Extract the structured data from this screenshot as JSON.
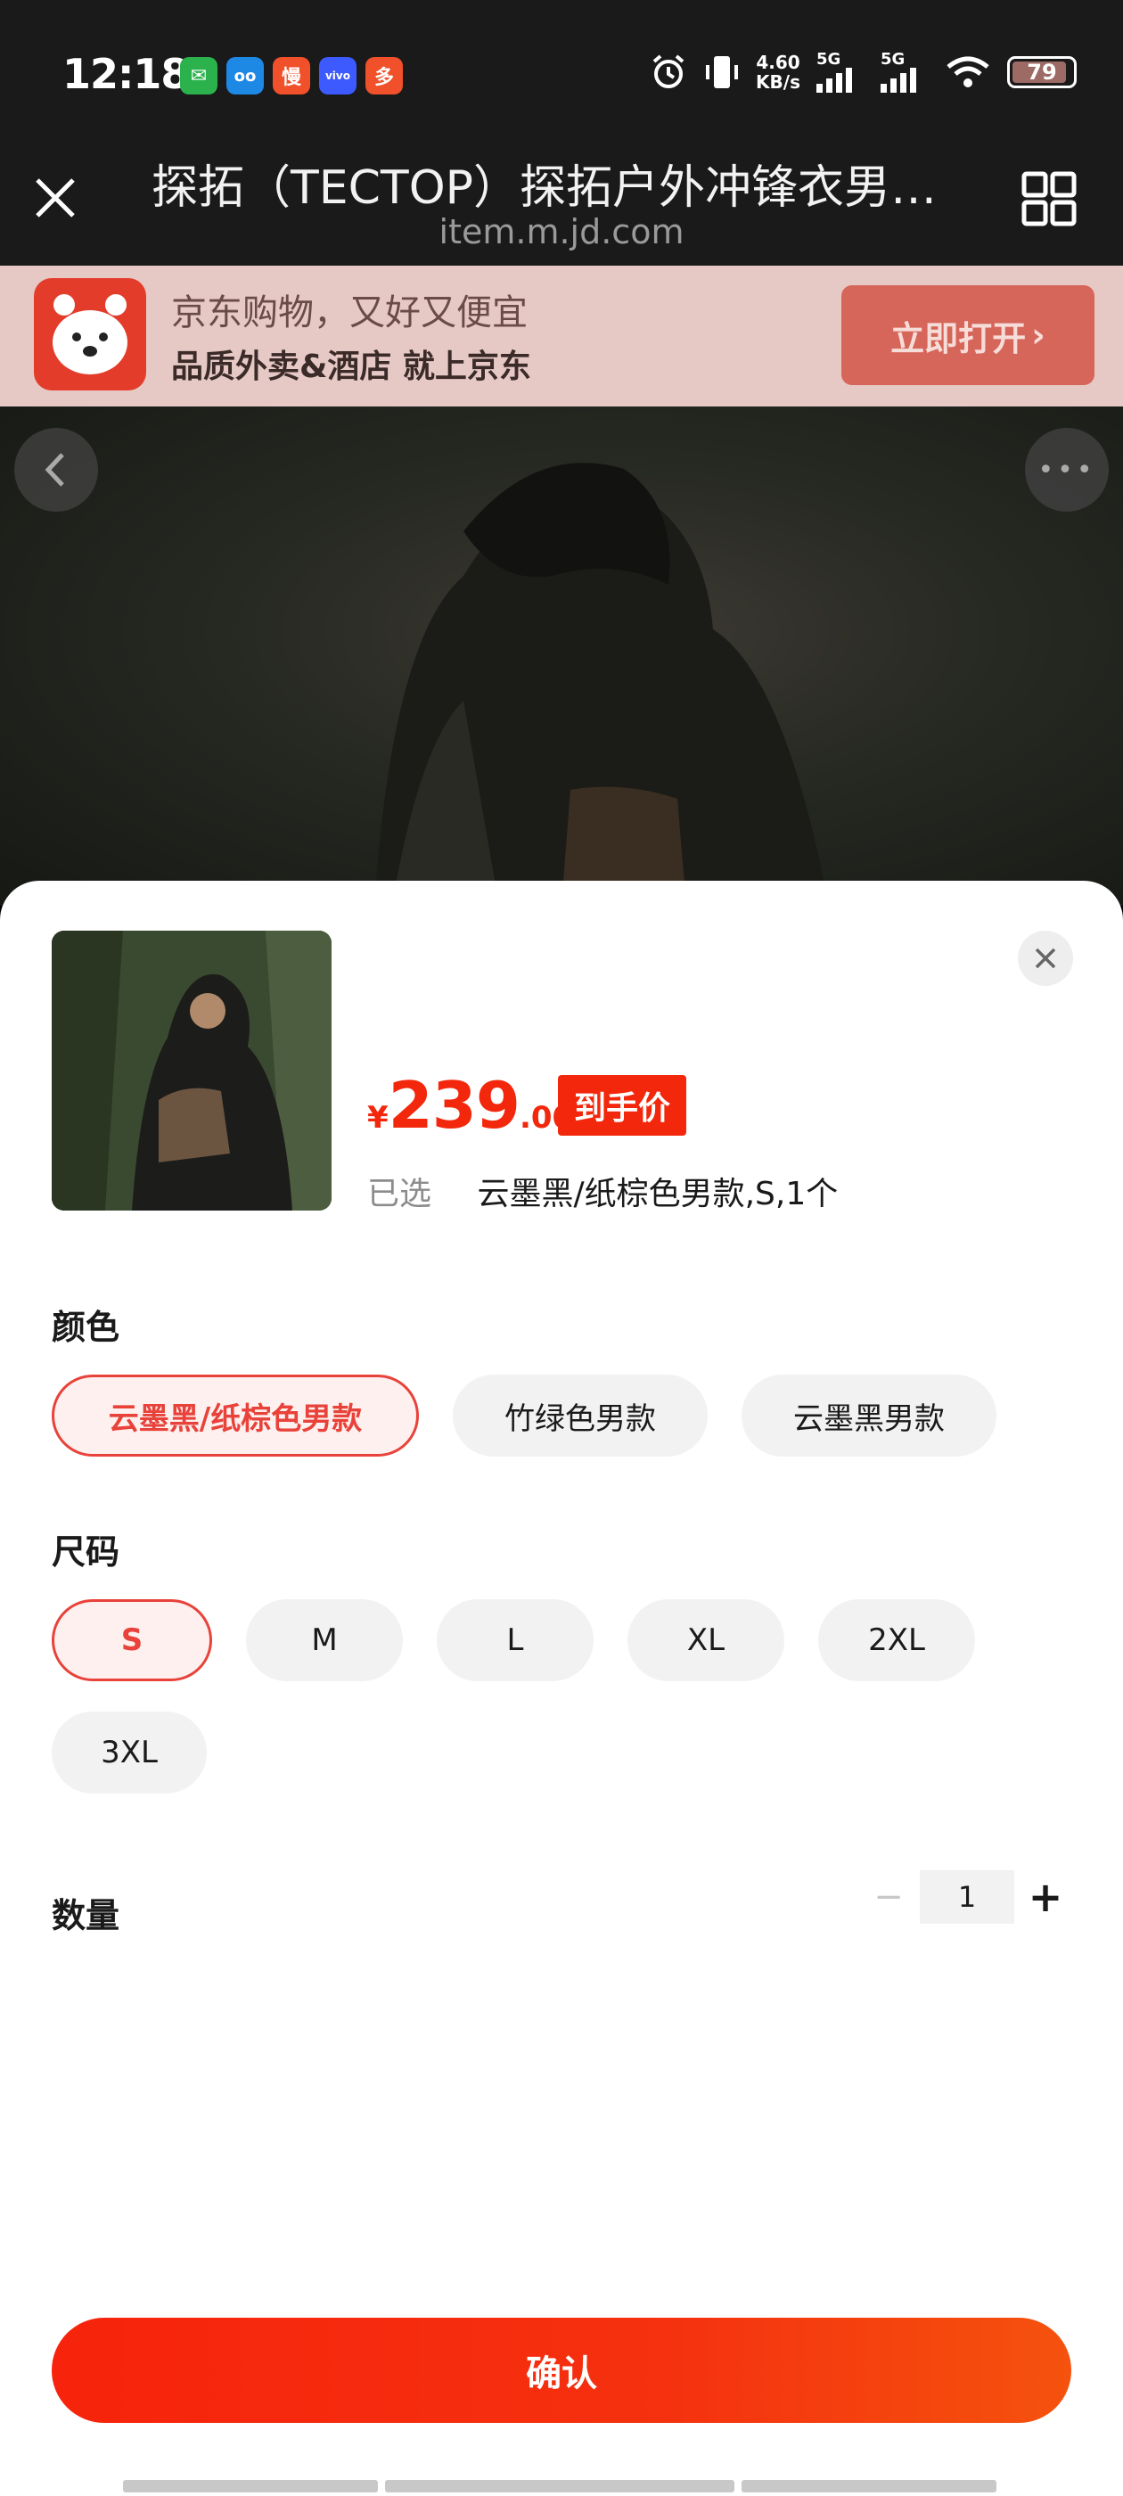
{
  "status_bar": {
    "time": "12:18",
    "apps": [
      {
        "icon": "wechat-icon",
        "color": "#2bb24c",
        "glyph": "✉"
      },
      {
        "icon": "qq-bird-icon",
        "color": "#1e88e5",
        "glyph": "oo"
      },
      {
        "icon": "man-app-icon",
        "color": "#f0502a",
        "glyph": "慢"
      },
      {
        "icon": "vivo-icon",
        "color": "#3d5afe",
        "glyph": "vivo"
      },
      {
        "icon": "pdd-icon",
        "color": "#f0502a",
        "glyph": "多"
      }
    ],
    "net_speed_value": "4.60",
    "net_speed_unit": "KB/s",
    "signal1_label": "5G",
    "signal2_label": "5G",
    "battery": "79"
  },
  "browser": {
    "title": "探拓（TECTOP）探拓户外冲锋衣男女同款",
    "url": "item.m.jd.com"
  },
  "banner": {
    "line1": "京东购物，又好又便宜",
    "line2": "品质外卖&酒店 就上京东",
    "open_button": "立即打开"
  },
  "sheet": {
    "price_currency": "¥",
    "price_integer": "239",
    "price_decimal": ".00",
    "price_badge": "到手价",
    "selected_label": "已选",
    "selected_value": "云墨黑/纸棕色男款,S,1个",
    "color_label": "颜色",
    "colors": [
      "云墨黑/纸棕色男款",
      "竹绿色男款",
      "云墨黑男款"
    ],
    "size_label": "尺码",
    "sizes": [
      "S",
      "M",
      "L",
      "XL",
      "2XL",
      "3XL"
    ],
    "quantity_label": "数量",
    "quantity_minus": "−",
    "quantity_value": "1",
    "quantity_plus": "+",
    "confirm": "确认"
  },
  "colors": {
    "accent": "#f2270c",
    "chip_active_border": "#e8423a"
  }
}
